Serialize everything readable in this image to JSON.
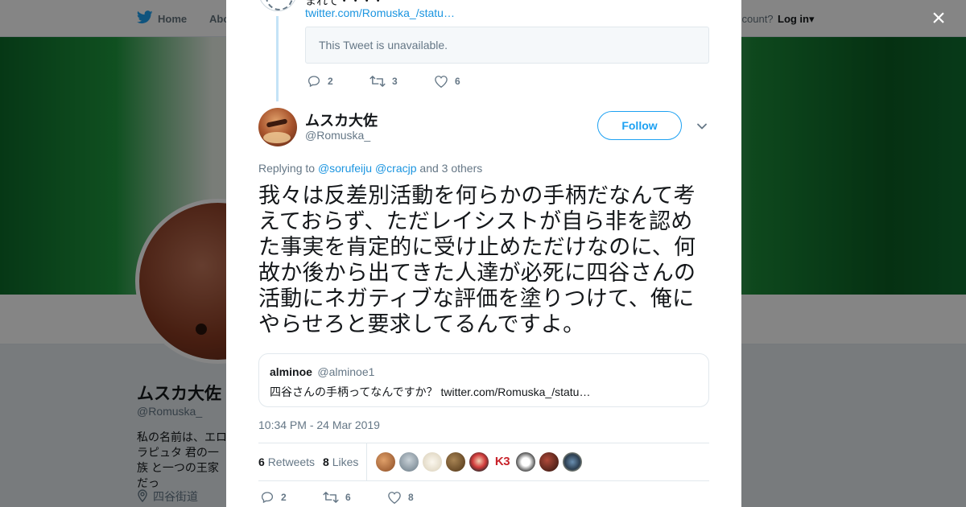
{
  "background": {
    "nav": {
      "home": "Home",
      "about": "Abo",
      "account": "ccount?",
      "login": "Log in"
    },
    "profile": {
      "name": "ムスカ大佐",
      "handle": "@Romuska_",
      "bio": "私の名前は、エロ ラピュタ 君の一族 と一つの王家だっ",
      "location": "四谷街道"
    }
  },
  "modal": {
    "close_label": "×",
    "previous_tweet": {
      "text_cut": "まれて・・・・",
      "link": "twitter.com/Romuska_/statu…",
      "unavailable": "This Tweet is unavailable.",
      "replies": "2",
      "retweets": "3",
      "likes": "6"
    },
    "tweet": {
      "author_name": "ムスカ大佐",
      "author_handle": "@Romuska_",
      "follow_label": "Follow",
      "replying_prefix": "Replying to",
      "mention_1": "@sorufeiju",
      "mention_2": "@cracjp",
      "replying_suffix": "and 3 others",
      "text": "我々は反差別活動を何らかの手柄だなんて考えておらず、ただレイシストが自ら非を認めた事実を肯定的に受け止めただけなのに、何故か後から出てきた人達が必死に四谷さんの活動にネガティブな評価を塗りつけて、俺にやらせろと要求してるんですよ。",
      "quote": {
        "name": "alminoe",
        "handle": "@alminoe1",
        "text": "四谷さんの手柄ってなんですか？ twitter.com/Romuska_/statu…"
      },
      "timestamp": "10:34 PM - 24 Mar 2019",
      "retweets_count": "6",
      "retweets_label": "Retweets",
      "likes_count": "8",
      "likes_label": "Likes",
      "k3_label": "K3",
      "replies": "2",
      "retweets": "6",
      "likes": "8"
    }
  },
  "colors": {
    "accent": "#1da1f2",
    "link": "#1b95e0",
    "muted": "#657786",
    "text": "#14171a"
  }
}
